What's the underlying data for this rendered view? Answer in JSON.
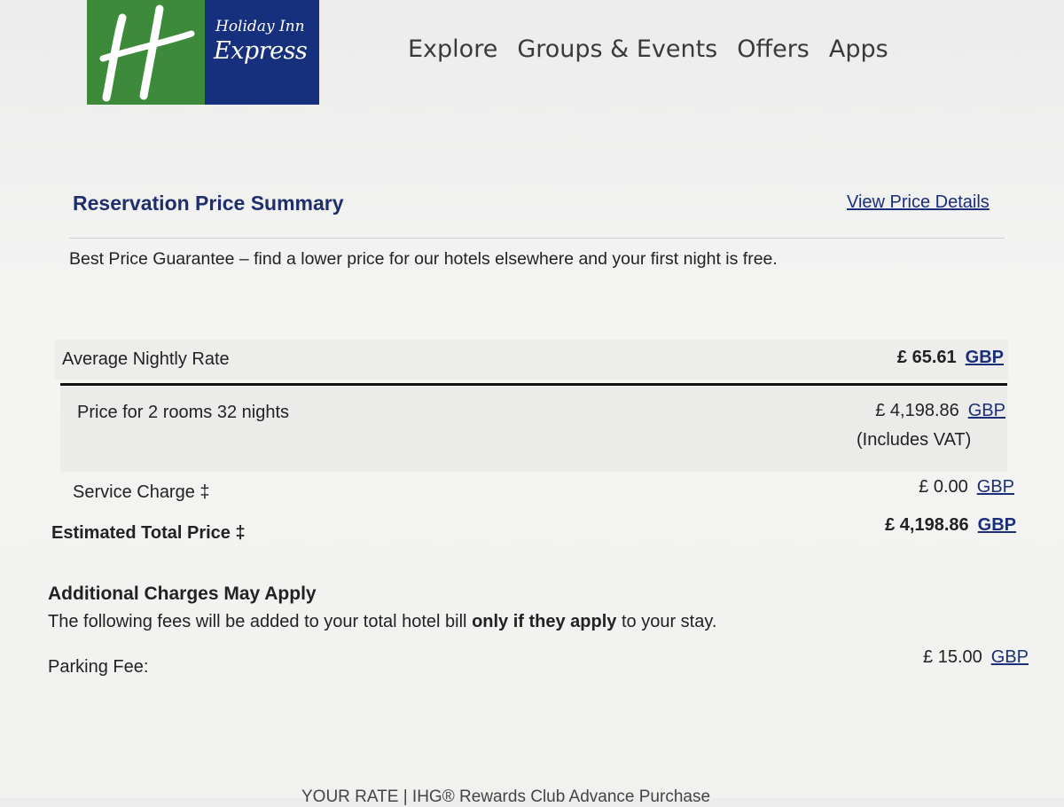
{
  "brand": {
    "line1": "Holiday Inn",
    "line2": "Express"
  },
  "nav": [
    "Explore",
    "Groups & Events",
    "Offers",
    "Apps"
  ],
  "summary": {
    "title": "Reservation Price Summary",
    "view_details": "View Price Details",
    "guarantee": "Best Price Guarantee – find a lower price for our hotels elsewhere and your first night is free."
  },
  "rows": {
    "avg_rate": {
      "label": "Average Nightly Rate",
      "value": "£ 65.61",
      "currency": "GBP"
    },
    "price": {
      "label": "Price for 2 rooms 32 nights",
      "value": "£ 4,198.86",
      "currency": "GBP",
      "note": "(Includes VAT)"
    },
    "service": {
      "label": "Service Charge ‡",
      "value": "£ 0.00",
      "currency": "GBP"
    },
    "total": {
      "label": "Estimated Total Price ‡",
      "value": "£ 4,198.86",
      "currency": "GBP"
    }
  },
  "additional": {
    "title": "Additional Charges May Apply",
    "text_before": "The following fees will be added to your total hotel bill ",
    "text_bold": "only if they apply",
    "text_after": " to your stay.",
    "parking_label": "Parking Fee:",
    "parking_value": "£ 15.00",
    "parking_currency": "GBP"
  },
  "footer": "YOUR RATE | IHG® Rewards Club Advance Purchase",
  "colors": {
    "logo_green": "#3d8a3a",
    "logo_blue": "#16307e",
    "link": "#1b2f78",
    "title": "#1f2f6b"
  }
}
